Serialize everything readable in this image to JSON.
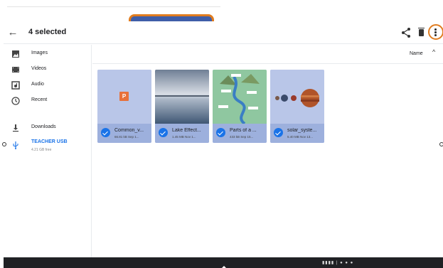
{
  "header": {
    "title": "4 selected",
    "back_icon": "arrow-back-icon",
    "share_icon": "share-icon",
    "delete_icon": "trash-icon",
    "more_icon": "more-vert-icon"
  },
  "sidebar": {
    "items": [
      {
        "label": "Images",
        "icon": "image-icon"
      },
      {
        "label": "Videos",
        "icon": "video-icon"
      },
      {
        "label": "Audio",
        "icon": "audio-icon"
      },
      {
        "label": "Recent",
        "icon": "clock-icon"
      },
      {
        "label": "Downloads",
        "icon": "download-icon"
      },
      {
        "label": "TEACHER USB",
        "sub": "4.21 GB free",
        "icon": "usb-icon"
      }
    ]
  },
  "toolbar": {
    "sort_label": "Name",
    "sort_icon": "chevron-up-icon"
  },
  "files": [
    {
      "name": "Common_v...",
      "meta": "66.81 kB Sep 1..."
    },
    {
      "name": "Lake Effect...",
      "meta": "1.45 MB Nov 1..."
    },
    {
      "name": "Parts of a ...",
      "meta": "433 kB Sep 15..."
    },
    {
      "name": "solar_syste...",
      "meta": "5.40 MB Nov 13..."
    }
  ],
  "colors": {
    "accent": "#1a73e8",
    "selected_card": "#b9c6e8",
    "highlight_ring": "#e07c1f",
    "shelf": "#202124"
  }
}
